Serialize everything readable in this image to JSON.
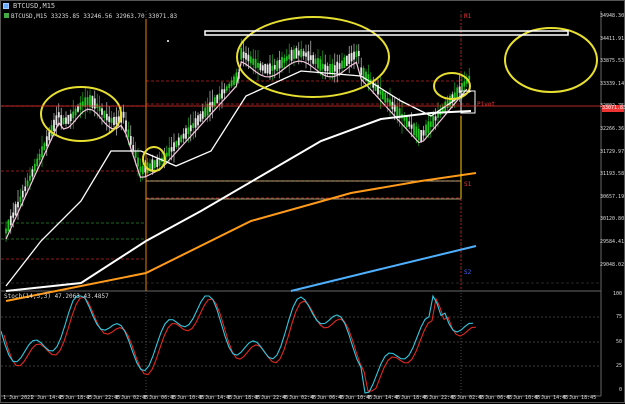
{
  "window": {
    "title": "BTCUSD,M15"
  },
  "info_line": "BTCUSD,M15  33235.85 33246.56 32963.70 33071.83",
  "osc_info": "Stoch(14,3,3) 47.2063 43.4857",
  "price_labels": [
    "34948.30",
    "34411.91",
    "33875.53",
    "33339.14",
    "32802.75",
    "32266.36",
    "31729.97",
    "31193.58",
    "30657.19",
    "30120.80",
    "29584.41",
    "29048.02"
  ],
  "current_price": "33071.83",
  "osc_labels": [
    "100",
    "75",
    "50",
    "25",
    "0"
  ],
  "time_labels": [
    "1 Jun 2021",
    "2 Jun 14:45",
    "2 Jun 18:45",
    "2 Jun 22:45",
    "3 Jun 02:45",
    "3 Jun 06:45",
    "3 Jun 10:45",
    "3 Jun 14:45",
    "3 Jun 18:45",
    "3 Jun 22:45",
    "4 Jun 02:45",
    "4 Jun 06:45",
    "4 Jun 10:45",
    "4 Jun 14:45",
    "4 Jun 18:45",
    "4 Jun 22:45",
    "5 Jun 02:45",
    "5 Jun 06:45",
    "5 Jun 10:45",
    "5 Jun 14:45",
    "5 Jun 18:45"
  ],
  "levels": {
    "r1": "R1",
    "pivot": "Pivot",
    "s1": "S1",
    "s2": "S2"
  },
  "colors": {
    "bull": "#22c422",
    "bear": "#e8e8e8",
    "ma_fast": "#f5c8e0",
    "ma_mid": "#ffffff",
    "ma_slow": "#ff9a1a",
    "ma_long": "#4fb0ff",
    "stoch_main": "#34c8e0",
    "stoch_signal": "#e02a20",
    "level": "#cc2222",
    "ellipse": "#e8e030"
  }
}
